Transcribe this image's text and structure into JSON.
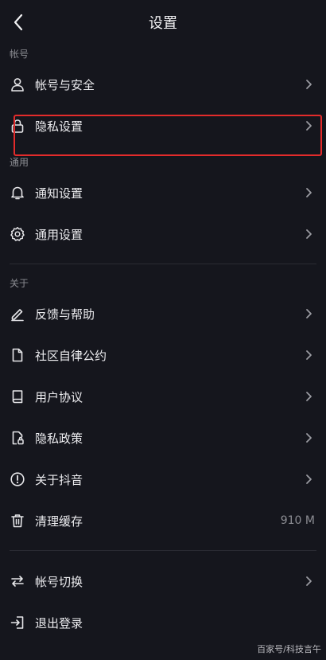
{
  "header": {
    "title": "设置"
  },
  "sections": {
    "account": {
      "label": "帐号",
      "items": [
        {
          "label": "帐号与安全"
        },
        {
          "label": "隐私设置"
        }
      ]
    },
    "general": {
      "label": "通用",
      "items": [
        {
          "label": "通知设置"
        },
        {
          "label": "通用设置"
        }
      ]
    },
    "about": {
      "label": "关于",
      "items": [
        {
          "label": "反馈与帮助"
        },
        {
          "label": "社区自律公约"
        },
        {
          "label": "用户协议"
        },
        {
          "label": "隐私政策"
        },
        {
          "label": "关于抖音"
        },
        {
          "label": "清理缓存",
          "value": "910 M"
        }
      ]
    },
    "session": {
      "items": [
        {
          "label": "帐号切换"
        },
        {
          "label": "退出登录"
        }
      ]
    }
  },
  "highlight_color": "#e32b2b",
  "watermark": "百家号/科技言午"
}
